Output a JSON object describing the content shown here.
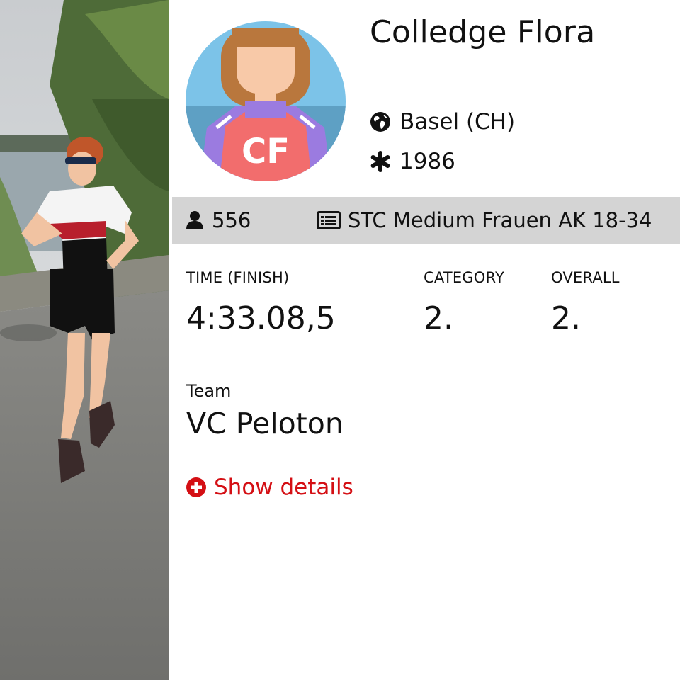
{
  "athlete": {
    "initials": "CF",
    "name": "Colledge Flora",
    "city": "Basel (CH)",
    "birth_year": "1986",
    "bib": "556",
    "category_name": "STC Medium Frauen AK 18-34",
    "team_label": "Team",
    "team": "VC Peloton"
  },
  "stats": [
    {
      "label": "TIME (FINISH)",
      "value": "4:33.08,5"
    },
    {
      "label": "CATEGORY",
      "value": "2."
    },
    {
      "label": "OVERALL",
      "value": "2."
    }
  ],
  "actions": {
    "show_details": "Show details"
  },
  "icons": {
    "city": "globe-icon",
    "year": "asterisk-icon",
    "bib": "user-icon",
    "category": "list-icon",
    "details": "plus-circle-icon"
  },
  "colors": {
    "accent": "#d40f14",
    "bar_bg": "#d4d4d4",
    "avatar_bg": "#7cc3e8",
    "avatar_shirt": "#f26d6d",
    "avatar_collar": "#9b7be0",
    "avatar_hair": "#b9773d",
    "avatar_skin": "#f8c9a8"
  }
}
